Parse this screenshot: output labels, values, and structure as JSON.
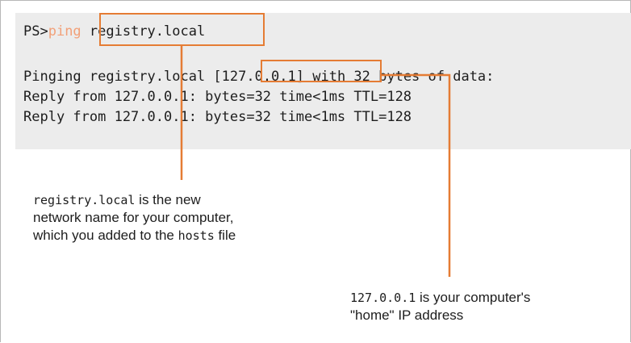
{
  "console": {
    "prompt": "PS>",
    "command": "ping",
    "host_arg": " registry.local",
    "ping_prefix": "Pinging registry.local ",
    "ping_ip": "[127.0.0.1]",
    "ping_suffix": " with 32 bytes of data:",
    "replies": [
      "Reply from 127.0.0.1: bytes=32 time<1ms TTL=128",
      "Reply from 127.0.0.1: bytes=32 time<1ms TTL=128"
    ]
  },
  "annotations": {
    "host_note": {
      "code": "registry.local",
      "text1": " is the new",
      "line2": "network name for your computer,",
      "line3_text": "which you added to the ",
      "line3_code": "hosts",
      "line3_end": " file"
    },
    "ip_note": {
      "code": "127.0.0.1",
      "text1": " is your computer's",
      "line2": "\"home\" IP address"
    }
  },
  "colors": {
    "accent": "#e57c34",
    "command": "#f2a078",
    "console_bg": "#ececec"
  }
}
